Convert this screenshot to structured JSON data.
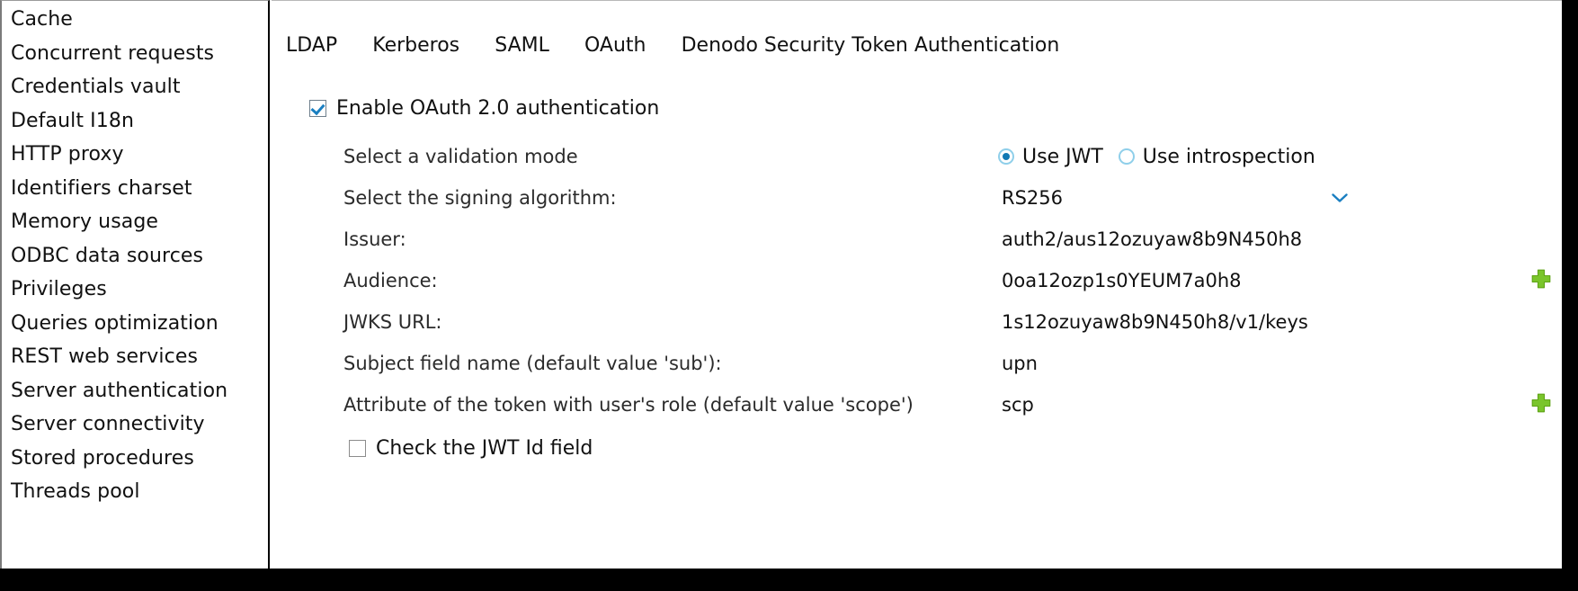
{
  "sidebar": {
    "items": [
      {
        "label": "Cache"
      },
      {
        "label": "Concurrent requests"
      },
      {
        "label": "Credentials vault"
      },
      {
        "label": "Default I18n"
      },
      {
        "label": "HTTP proxy"
      },
      {
        "label": "Identifiers charset"
      },
      {
        "label": "Memory usage"
      },
      {
        "label": "ODBC data sources"
      },
      {
        "label": "Privileges"
      },
      {
        "label": "Queries optimization"
      },
      {
        "label": "REST web services"
      },
      {
        "label": "Server authentication"
      },
      {
        "label": "Server connectivity"
      },
      {
        "label": "Stored procedures"
      },
      {
        "label": "Threads pool"
      }
    ]
  },
  "tabs": [
    {
      "label": "LDAP",
      "selected": false
    },
    {
      "label": "Kerberos",
      "selected": false
    },
    {
      "label": "SAML",
      "selected": false
    },
    {
      "label": "OAuth",
      "selected": true
    },
    {
      "label": "Denodo Security Token Authentication",
      "selected": false
    }
  ],
  "enable": {
    "label": "Enable OAuth 2.0 authentication",
    "checked": true
  },
  "validation_mode": {
    "label": "Select a validation mode",
    "options": [
      {
        "label": "Use JWT",
        "selected": true
      },
      {
        "label": "Use introspection",
        "selected": false
      }
    ]
  },
  "signing_algorithm": {
    "label": "Select the signing algorithm:",
    "value": "RS256"
  },
  "fields": [
    {
      "label": "Issuer:",
      "value": "auth2/aus12ozuyaw8b9N450h8",
      "has_add": false
    },
    {
      "label": "Audience:",
      "value": "0oa12ozp1s0YEUM7a0h8",
      "has_add": true
    },
    {
      "label": "JWKS URL:",
      "value": "1s12ozuyaw8b9N450h8/v1/keys",
      "has_add": false
    },
    {
      "label": "Subject field name (default value 'sub'):",
      "value": "upn",
      "has_add": false
    },
    {
      "label": "Attribute of the token with user's role (default value 'scope')",
      "value": "scp",
      "has_add": true
    }
  ],
  "jwt_id": {
    "label": "Check the JWT Id field",
    "checked": false
  },
  "colors": {
    "accent_blue": "#1178b3",
    "radio_ring": "#8fcfea",
    "add_green": "#7ac52b",
    "chevron_blue": "#1a7fc1",
    "chrome_black": "#000000"
  }
}
